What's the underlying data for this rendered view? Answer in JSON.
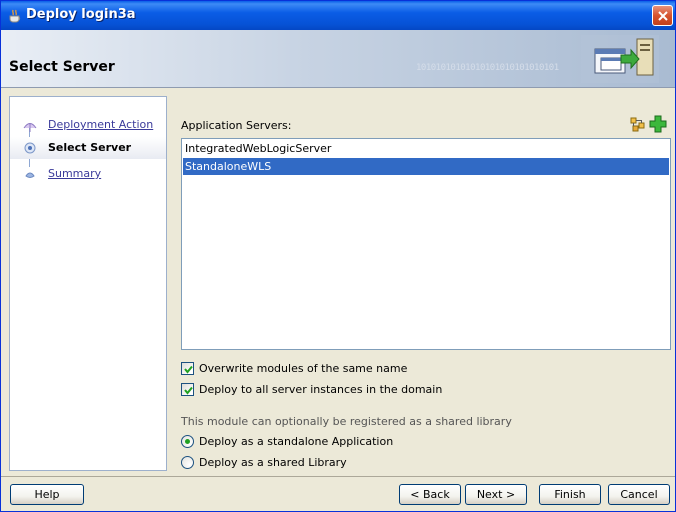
{
  "window": {
    "title": "Deploy login3a",
    "colors": {
      "titlebar": "#0A5FE8",
      "selection": "#316AC5",
      "radio_dot": "#21A121"
    }
  },
  "header": {
    "title": "Select Server",
    "binary_text": "10101010101010101010101010101"
  },
  "nav": {
    "items": [
      {
        "label": "Deployment Action",
        "state": "visited"
      },
      {
        "label": "Select Server",
        "state": "current"
      },
      {
        "label": "Summary",
        "state": "pending"
      }
    ]
  },
  "servers": {
    "label": "Application Servers:",
    "list": [
      {
        "name": "IntegratedWebLogicServer",
        "selected": false
      },
      {
        "name": "StandaloneWLS",
        "selected": true
      }
    ],
    "toolbar": [
      {
        "icon": "browse-servers-icon"
      },
      {
        "icon": "add-server-icon"
      }
    ]
  },
  "options": {
    "overwrite": {
      "label": "Overwrite modules of the same name",
      "checked": true
    },
    "deploy_all": {
      "label": "Deploy to all server instances in the domain",
      "checked": true
    },
    "shared_hint": "This module can optionally be registered as a shared library",
    "deploy_mode": [
      {
        "label": "Deploy as a standalone Application",
        "selected": true
      },
      {
        "label": "Deploy as a shared Library",
        "selected": false
      }
    ]
  },
  "buttons": {
    "help": "Help",
    "back": "< Back",
    "next": "Next >",
    "finish": "Finish",
    "cancel": "Cancel"
  }
}
